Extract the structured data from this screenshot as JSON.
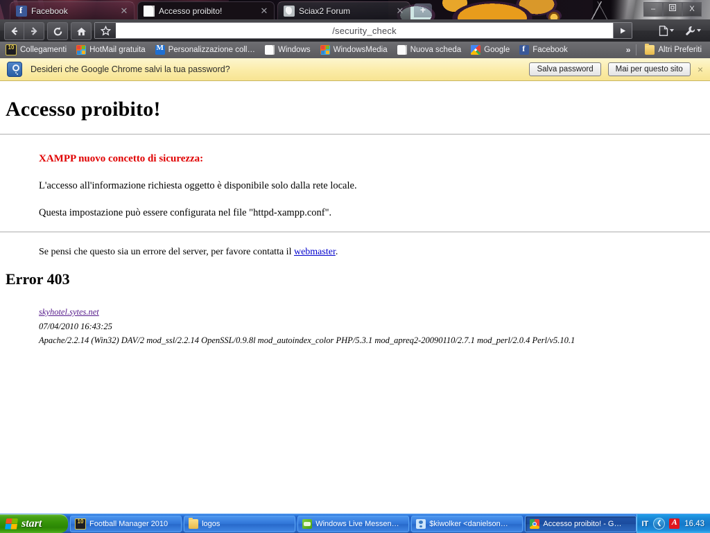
{
  "browser": {
    "tabs": [
      {
        "label": "Facebook",
        "icon": "facebook-favicon",
        "active": false
      },
      {
        "label": "Accesso proibito!",
        "icon": "document-favicon",
        "active": true
      },
      {
        "label": "Sciax2 Forum",
        "icon": "rabbit-favicon",
        "active": false
      }
    ],
    "new_tab_label": "+",
    "window_controls": {
      "minimize": "–",
      "maximize": "❐",
      "close": "X"
    },
    "toolbar": {
      "back_label": "Back",
      "forward_label": "Forward",
      "reload_label": "Reload",
      "home_label": "Home",
      "go_label": "Go",
      "page_menu_label": "Page menu",
      "wrench_menu_label": "Tools menu"
    },
    "omnibox": {
      "value": "/security_check",
      "placeholder": ""
    },
    "bookmarks": [
      {
        "label": "Collegamenti",
        "icon": "fm-icon"
      },
      {
        "label": "HotMail gratuita",
        "icon": "windows-icon"
      },
      {
        "label": "Personalizzazione coll…",
        "icon": "msn-icon"
      },
      {
        "label": "Windows",
        "icon": "document-icon"
      },
      {
        "label": "WindowsMedia",
        "icon": "windows-icon"
      },
      {
        "label": "Nuova scheda",
        "icon": "document-icon"
      },
      {
        "label": "Google",
        "icon": "google-icon"
      },
      {
        "label": "Facebook",
        "icon": "facebook-icon"
      }
    ],
    "bookmarks_overflow": "»",
    "other_bookmarks": "Altri Preferiti"
  },
  "infobar": {
    "message": "Desideri che Google Chrome salvi la tua password?",
    "save_label": "Salva password",
    "never_label": "Mai per questo sito",
    "close_label": "×"
  },
  "page": {
    "heading": "Accesso proibito!",
    "xampp_title": "XAMPP nuovo concetto di sicurezza:",
    "paragraph1": "L'accesso all'informazione richiesta oggetto è disponibile solo dalla rete locale.",
    "paragraph2": "Questa impostazione può essere configurata nel file \"httpd-xampp.conf\".",
    "contact_prefix": "Se pensi che questo sia un errore del server, per favore contatta il ",
    "contact_link": "webmaster",
    "contact_suffix": ".",
    "error_heading": "Error 403",
    "signature": {
      "host": "skyhotel.sytes.net",
      "timestamp": "07/04/2010 16:43:25",
      "server": "Apache/2.2.14 (Win32) DAV/2 mod_ssl/2.2.14 OpenSSL/0.9.8l mod_autoindex_color PHP/5.3.1 mod_apreq2-20090110/2.7.1 mod_perl/2.0.4 Perl/v5.10.1"
    }
  },
  "taskbar": {
    "start_label": "start",
    "items": [
      {
        "label": "Football Manager 2010",
        "icon": "fm-icon",
        "active": false
      },
      {
        "label": "logos",
        "icon": "folder-icon",
        "active": false
      },
      {
        "label": "Windows Live Messen…",
        "icon": "msn-icon",
        "active": false
      },
      {
        "label": "$kiwolker  <danielson…",
        "icon": "messenger-icon",
        "active": false
      },
      {
        "label": "Accesso proibito! - G…",
        "icon": "chrome-icon",
        "active": true
      }
    ],
    "tray": {
      "language": "IT",
      "chevron": "❮",
      "antivirus": "avira-icon",
      "clock": "16.43"
    }
  },
  "colors": {
    "accent_red": "#e00000",
    "link_blue": "#0000cc",
    "visited_purple": "#551a8b",
    "infobar_yellow": "#fbeca8",
    "taskbar_blue": "#2e75d6",
    "start_green": "#359408"
  }
}
